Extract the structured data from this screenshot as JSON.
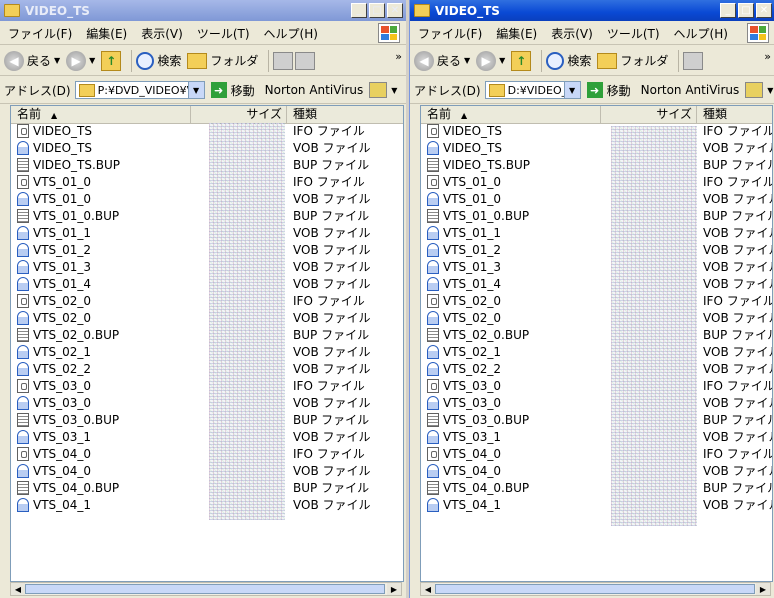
{
  "colors": {
    "inactive_title": "#8ba0d9",
    "active_title": "#0a49d4",
    "chrome": "#ece9d8",
    "accent": "#2a5fc0"
  },
  "left": {
    "title": "VIDEO_TS",
    "menu": [
      "ファイル(F)",
      "編集(E)",
      "表示(V)",
      "ツール(T)",
      "ヘルプ(H)"
    ],
    "toolbar": {
      "back": "戻る",
      "search": "検索",
      "folders": "フォルダ"
    },
    "address": {
      "label": "アドレス(D)",
      "value": "P:¥DVD_VIDEO¥V",
      "go": "移動",
      "extra": "Norton AntiVirus"
    },
    "columns": {
      "name": "名前",
      "size": "サイズ",
      "type": "種類"
    },
    "files": [
      {
        "name": "VIDEO_TS",
        "type": "IFO ファイル",
        "icon": "ifo"
      },
      {
        "name": "VIDEO_TS",
        "type": "VOB ファイル",
        "icon": "vob"
      },
      {
        "name": "VIDEO_TS.BUP",
        "type": "BUP ファイル",
        "icon": "bup"
      },
      {
        "name": "VTS_01_0",
        "type": "IFO ファイル",
        "icon": "ifo"
      },
      {
        "name": "VTS_01_0",
        "type": "VOB ファイル",
        "icon": "vob"
      },
      {
        "name": "VTS_01_0.BUP",
        "type": "BUP ファイル",
        "icon": "bup"
      },
      {
        "name": "VTS_01_1",
        "type": "VOB ファイル",
        "icon": "vob"
      },
      {
        "name": "VTS_01_2",
        "type": "VOB ファイル",
        "icon": "vob"
      },
      {
        "name": "VTS_01_3",
        "type": "VOB ファイル",
        "icon": "vob"
      },
      {
        "name": "VTS_01_4",
        "type": "VOB ファイル",
        "icon": "vob"
      },
      {
        "name": "VTS_02_0",
        "type": "IFO ファイル",
        "icon": "ifo"
      },
      {
        "name": "VTS_02_0",
        "type": "VOB ファイル",
        "icon": "vob"
      },
      {
        "name": "VTS_02_0.BUP",
        "type": "BUP ファイル",
        "icon": "bup"
      },
      {
        "name": "VTS_02_1",
        "type": "VOB ファイル",
        "icon": "vob"
      },
      {
        "name": "VTS_02_2",
        "type": "VOB ファイル",
        "icon": "vob"
      },
      {
        "name": "VTS_03_0",
        "type": "IFO ファイル",
        "icon": "ifo"
      },
      {
        "name": "VTS_03_0",
        "type": "VOB ファイル",
        "icon": "vob"
      },
      {
        "name": "VTS_03_0.BUP",
        "type": "BUP ファイル",
        "icon": "bup"
      },
      {
        "name": "VTS_03_1",
        "type": "VOB ファイル",
        "icon": "vob"
      },
      {
        "name": "VTS_04_0",
        "type": "IFO ファイル",
        "icon": "ifo"
      },
      {
        "name": "VTS_04_0",
        "type": "VOB ファイル",
        "icon": "vob"
      },
      {
        "name": "VTS_04_0.BUP",
        "type": "BUP ファイル",
        "icon": "bup"
      },
      {
        "name": "VTS_04_1",
        "type": "VOB ファイル",
        "icon": "vob"
      }
    ]
  },
  "right": {
    "title": "VIDEO_TS",
    "menu": [
      "ファイル(F)",
      "編集(E)",
      "表示(V)",
      "ツール(T)",
      "ヘルプ(H)"
    ],
    "toolbar": {
      "back": "戻る",
      "search": "検索",
      "folders": "フォルダ"
    },
    "address": {
      "label": "アドレス(D)",
      "value": "D:¥VIDEO_T",
      "go": "移動",
      "extra": "Norton AntiVirus"
    },
    "columns": {
      "name": "名前",
      "size": "サイズ",
      "type": "種類"
    },
    "files": [
      {
        "name": "VIDEO_TS",
        "type": "IFO ファイル",
        "icon": "ifo"
      },
      {
        "name": "VIDEO_TS",
        "type": "VOB ファイル",
        "icon": "vob"
      },
      {
        "name": "VIDEO_TS.BUP",
        "type": "BUP ファイル",
        "icon": "bup"
      },
      {
        "name": "VTS_01_0",
        "type": "IFO ファイル",
        "icon": "ifo"
      },
      {
        "name": "VTS_01_0",
        "type": "VOB ファイル",
        "icon": "vob"
      },
      {
        "name": "VTS_01_0.BUP",
        "type": "BUP ファイル",
        "icon": "bup"
      },
      {
        "name": "VTS_01_1",
        "type": "VOB ファイル",
        "icon": "vob"
      },
      {
        "name": "VTS_01_2",
        "type": "VOB ファイル",
        "icon": "vob"
      },
      {
        "name": "VTS_01_3",
        "type": "VOB ファイル",
        "icon": "vob"
      },
      {
        "name": "VTS_01_4",
        "type": "VOB ファイル",
        "icon": "vob"
      },
      {
        "name": "VTS_02_0",
        "type": "IFO ファイル",
        "icon": "ifo"
      },
      {
        "name": "VTS_02_0",
        "type": "VOB ファイル",
        "icon": "vob"
      },
      {
        "name": "VTS_02_0.BUP",
        "type": "BUP ファイル",
        "icon": "bup"
      },
      {
        "name": "VTS_02_1",
        "type": "VOB ファイル",
        "icon": "vob"
      },
      {
        "name": "VTS_02_2",
        "type": "VOB ファイル",
        "icon": "vob"
      },
      {
        "name": "VTS_03_0",
        "type": "IFO ファイル",
        "icon": "ifo"
      },
      {
        "name": "VTS_03_0",
        "type": "VOB ファイル",
        "icon": "vob"
      },
      {
        "name": "VTS_03_0.BUP",
        "type": "BUP ファイル",
        "icon": "bup"
      },
      {
        "name": "VTS_03_1",
        "type": "VOB ファイル",
        "icon": "vob"
      },
      {
        "name": "VTS_04_0",
        "type": "IFO ファイル",
        "icon": "ifo"
      },
      {
        "name": "VTS_04_0",
        "type": "VOB ファイル",
        "icon": "vob"
      },
      {
        "name": "VTS_04_0.BUP",
        "type": "BUP ファイル",
        "icon": "bup"
      },
      {
        "name": "VTS_04_1",
        "type": "VOB ファイル",
        "icon": "vob"
      }
    ]
  }
}
